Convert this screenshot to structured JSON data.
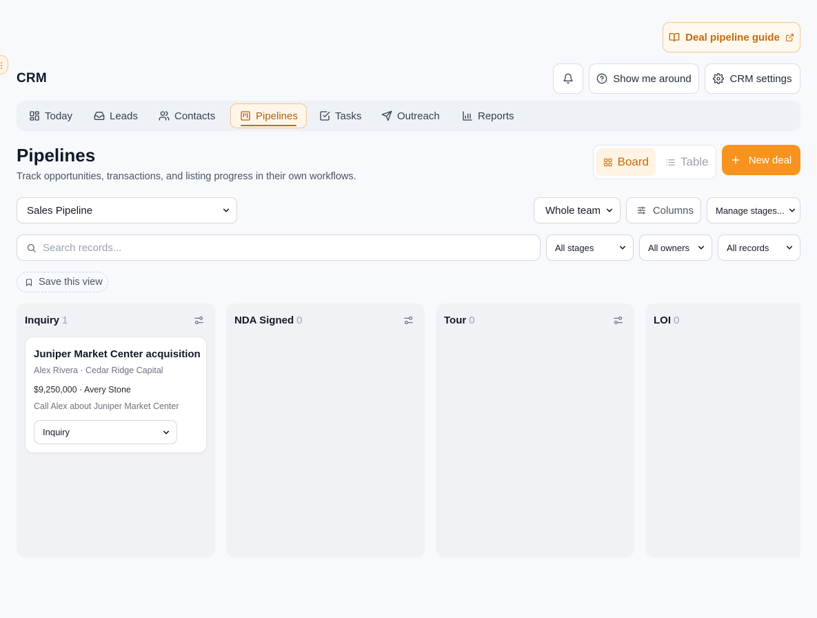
{
  "header": {
    "guide_label": "Deal pipeline guide",
    "app_title": "CRM",
    "tour_label": "Show me around",
    "settings_label": "CRM settings"
  },
  "tabs": [
    {
      "label": "Today",
      "icon": "grid-icon",
      "active": false
    },
    {
      "label": "Leads",
      "icon": "inbox-icon",
      "active": false
    },
    {
      "label": "Contacts",
      "icon": "users-icon",
      "active": false
    },
    {
      "label": "Pipelines",
      "icon": "kanban-icon",
      "active": true
    },
    {
      "label": "Tasks",
      "icon": "checkbox-icon",
      "active": false
    },
    {
      "label": "Outreach",
      "icon": "send-icon",
      "active": false
    },
    {
      "label": "Reports",
      "icon": "bar-chart-icon",
      "active": false
    }
  ],
  "page": {
    "title": "Pipelines",
    "subtitle": "Track opportunities, transactions, and listing progress in their own workflows."
  },
  "view_toggle": {
    "board_label": "Board",
    "table_label": "Table",
    "selected": "Board"
  },
  "new_deal_label": "New deal",
  "filters": {
    "pipeline": "Sales Pipeline",
    "team": "Whole team",
    "columns_label": "Columns",
    "manage_stages": "Manage stages...",
    "search_placeholder": "Search records...",
    "stages": "All stages",
    "owners": "All owners",
    "records": "All records",
    "save_view_label": "Save this view"
  },
  "columns": [
    {
      "name": "Inquiry",
      "count": "1"
    },
    {
      "name": "NDA Signed",
      "count": "0"
    },
    {
      "name": "Tour",
      "count": "0"
    },
    {
      "name": "LOI",
      "count": "0"
    }
  ],
  "deal_card": {
    "title": "Juniper Market Center acquisition",
    "contact": "Alex Rivera · Cedar Ridge Capital",
    "value_owner": "$9,250,000 · Avery Stone",
    "next_task": "Call Alex about Juniper Market Center",
    "stage": "Inquiry"
  },
  "colors": {
    "accent": "#f7931e",
    "accent_text": "#c26b0e",
    "background": "#f7f9fc",
    "column_bg": "#f0f2f5"
  }
}
